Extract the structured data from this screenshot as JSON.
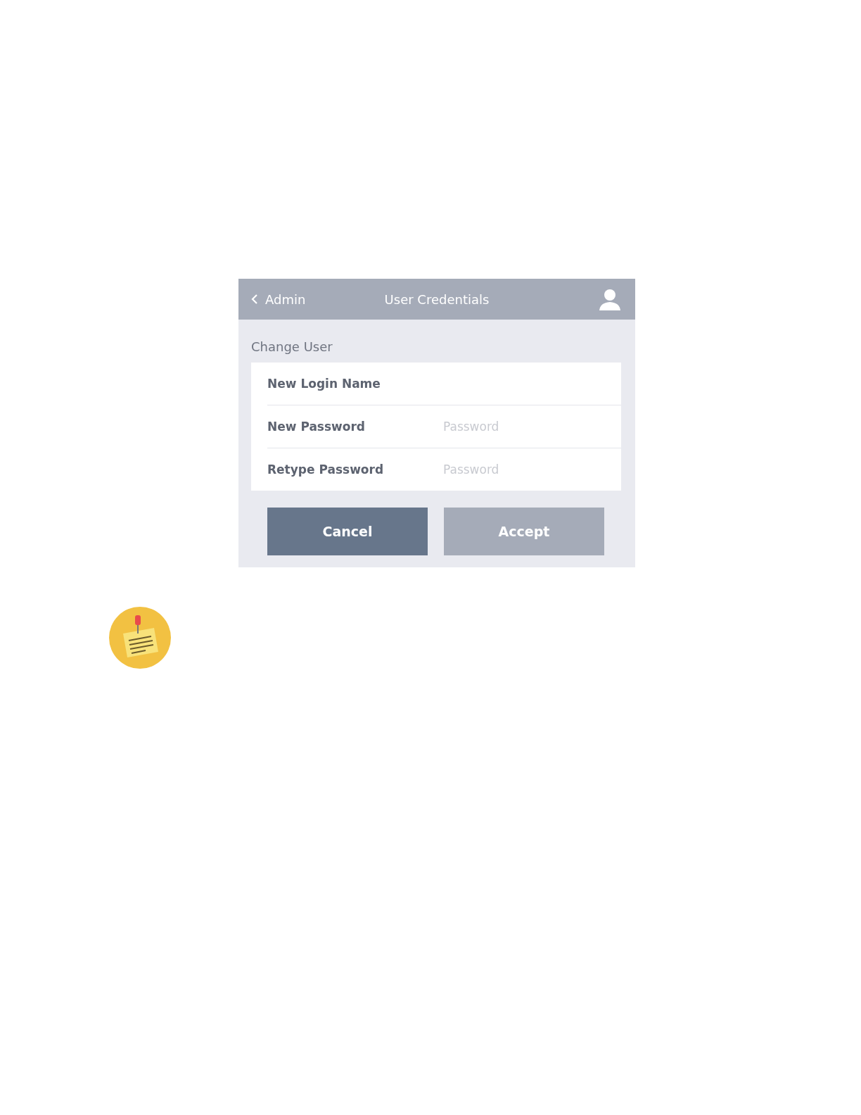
{
  "header": {
    "back_label": "Admin",
    "title": "User Credentials"
  },
  "section_title": "Change User",
  "fields": [
    {
      "label": "New Login Name"
    },
    {
      "label": "New Password",
      "placeholder": "Password"
    },
    {
      "label": "Retype Password",
      "placeholder": "Password"
    }
  ],
  "buttons": [
    {
      "label": "Cancel",
      "disabled": false
    },
    {
      "label": "Accept",
      "disabled": true
    }
  ]
}
